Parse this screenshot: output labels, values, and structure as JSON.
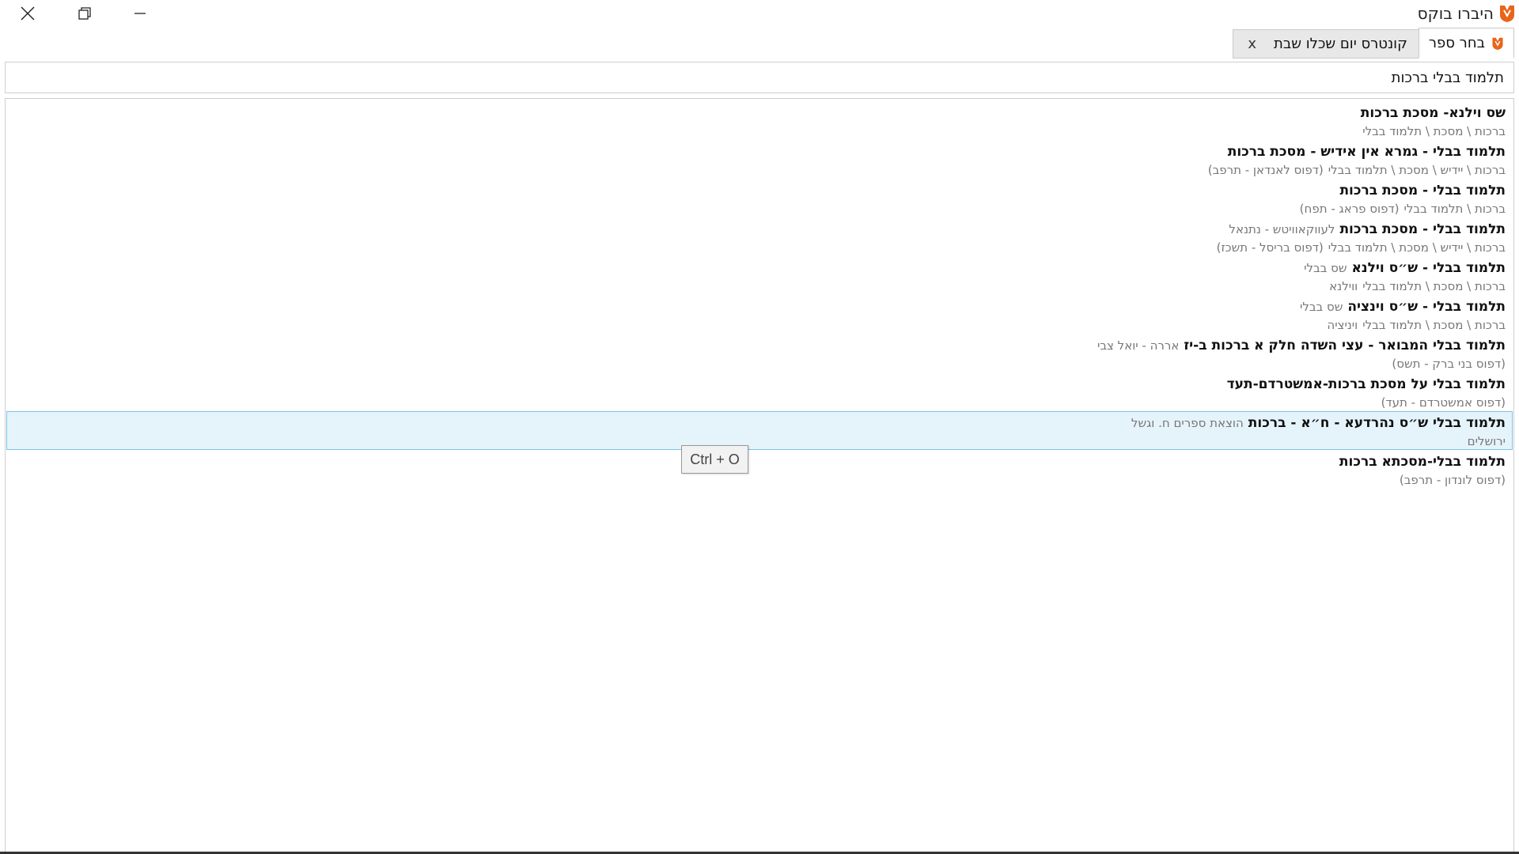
{
  "window": {
    "app_title": "היברו בוקס",
    "accent_color": "#e8651a"
  },
  "tabs": [
    {
      "label": "בחר ספר",
      "active": true,
      "icon": "app-logo-icon"
    },
    {
      "label": "קונטרס יום שכלו שבת",
      "active": false,
      "close_label": "x"
    }
  ],
  "search": {
    "value": "תלמוד בבלי ברכות"
  },
  "results": [
    {
      "title": "שס וילנא- מסכת ברכות",
      "author": "",
      "path": "ברכות \\ מסכת \\ תלמוד בבלי",
      "edition": ""
    },
    {
      "title": "תלמוד בבלי - גמרא אין אידיש - מסכת ברכות",
      "author": "",
      "path": "ברכות \\ יידיש \\ מסכת \\ תלמוד בבלי",
      "edition": "(דפוס לאנדאן - תרפב)"
    },
    {
      "title": "תלמוד בבלי - מסכת ברכות",
      "author": "",
      "path": "ברכות \\ תלמוד בבלי",
      "edition": "(דפוס פראג - תפח)"
    },
    {
      "title": "תלמוד בבלי - מסכת ברכות",
      "author": "לעווקאוויטש - נתנאל",
      "path": "ברכות \\ יידיש \\ מסכת \\ תלמוד בבלי",
      "edition": "(דפוס בריסל - תשכז)"
    },
    {
      "title": "תלמוד בבלי - ש״ס וילנא",
      "author": "שס בבלי",
      "path": "ברכות \\ מסכת \\ תלמוד בבלי",
      "edition": "ווילנא"
    },
    {
      "title": "תלמוד בבלי - ש״ס וינציה",
      "author": "שס בבלי",
      "path": "ברכות \\ מסכת \\ תלמוד בבלי",
      "edition": "ויניציה"
    },
    {
      "title": "תלמוד בבלי המבואר - עצי השדה חלק א ברכות ב-יז",
      "author": "אררה - יואל צבי",
      "path": "",
      "edition": "(דפוס בני ברק - תשס)"
    },
    {
      "title": "תלמוד בבלי על מסכת ברכות-אמשטרדם-תעד",
      "author": "",
      "path": "",
      "edition": "(דפוס אמשטרדם - תעד)"
    },
    {
      "title": "תלמוד בבלי ש״ס נהרדעא - ח״א - ברכות",
      "author": "הוצאת ספרים ח. וגשל",
      "path": "",
      "edition": "ירושלים",
      "selected": true
    },
    {
      "title": "תלמוד בבלי-מסכתא ברכות",
      "author": "",
      "path": "",
      "edition": "(דפוס לונדון - תרפב)"
    }
  ],
  "tooltip": {
    "text": "Ctrl + O"
  }
}
